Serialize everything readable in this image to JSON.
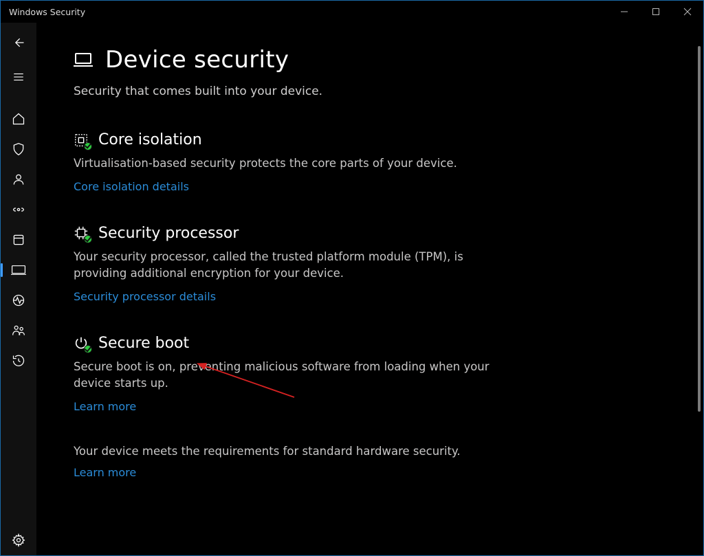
{
  "window": {
    "title": "Windows Security"
  },
  "page": {
    "title": "Device security",
    "subtitle": "Security that comes built into your device."
  },
  "sections": {
    "core": {
      "title": "Core isolation",
      "desc": "Virtualisation-based security protects the core parts of your device.",
      "link": "Core isolation details"
    },
    "proc": {
      "title": "Security processor",
      "desc": "Your security processor, called the trusted platform module (TPM), is providing additional encryption for your device.",
      "link": "Security processor details"
    },
    "boot": {
      "title": "Secure boot",
      "desc": "Secure boot is on, preventing malicious software from loading when your device starts up.",
      "link": "Learn more"
    }
  },
  "footer": {
    "text": "Your device meets the requirements for standard hardware security.",
    "link": "Learn more"
  }
}
